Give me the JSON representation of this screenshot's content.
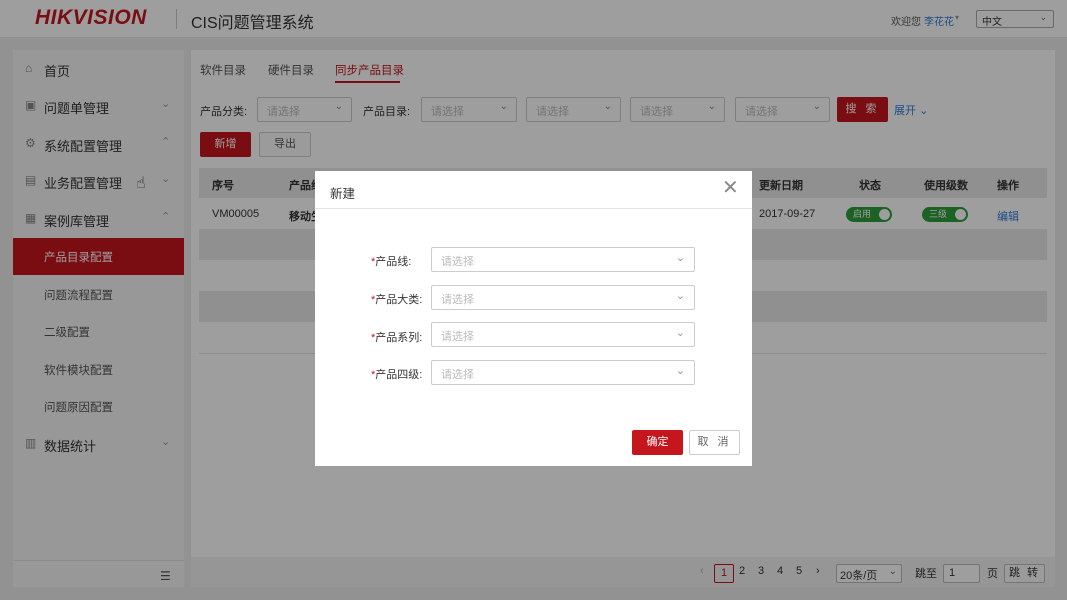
{
  "header": {
    "logo": "HIKVISION",
    "system_title": "CIS问题管理系统",
    "welcome": "欢迎您",
    "username": "李花花",
    "language": "中文"
  },
  "sidebar": {
    "items": [
      {
        "label": "首页",
        "icon": "home-icon"
      },
      {
        "label": "问题单管理",
        "icon": "ticket-icon",
        "chevron": "down"
      },
      {
        "label": "系统配置管理",
        "icon": "system-config-icon",
        "chevron": "up"
      },
      {
        "label": "业务配置管理",
        "icon": "business-config-icon",
        "chevron": "down"
      },
      {
        "label": "案例库管理",
        "icon": "case-library-icon",
        "chevron": "up"
      },
      {
        "label": "数据统计",
        "icon": "stats-icon",
        "chevron": "down"
      }
    ],
    "sub_items": [
      "产品目录配置",
      "问题流程配置",
      "二级配置",
      "软件模块配置",
      "问题原因配置"
    ],
    "active_sub": "产品目录配置"
  },
  "tabs": [
    "软件目录",
    "硬件目录",
    "同步产品目录"
  ],
  "active_tab": "同步产品目录",
  "filters": {
    "category_label": "产品分类:",
    "catalog_label": "产品目录:",
    "placeholder": "请选择",
    "search": "搜 索",
    "expand": "展开"
  },
  "actions": {
    "add": "新增",
    "export": "导出"
  },
  "table": {
    "headers": [
      "序号",
      "产品线",
      "更新日期",
      "状态",
      "使用级数",
      "操作"
    ],
    "rows": [
      {
        "id": "VM00005",
        "product_line": "移动生",
        "date": "2017-09-27",
        "status": "启用",
        "level": "三级",
        "action": "编辑"
      }
    ]
  },
  "pagination": {
    "pages": [
      "1",
      "2",
      "3",
      "4",
      "5"
    ],
    "current": "1",
    "page_size": "20条/页",
    "jump_label": "跳至",
    "jump_value": "1",
    "page_unit": "页",
    "jump_button": "跳 转"
  },
  "modal": {
    "title": "新建",
    "fields": [
      {
        "label": "产品线:",
        "placeholder": "请选择"
      },
      {
        "label": "产品大类:",
        "placeholder": "请选择"
      },
      {
        "label": "产品系列:",
        "placeholder": "请选择"
      },
      {
        "label": "产品四级:",
        "placeholder": "请选择"
      }
    ],
    "required_mark": "*",
    "ok": "确定",
    "cancel": "取 消"
  },
  "colors": {
    "brand": "#c4161c",
    "link": "#2f7cdb",
    "toggle_on": "#2e9e3a"
  }
}
